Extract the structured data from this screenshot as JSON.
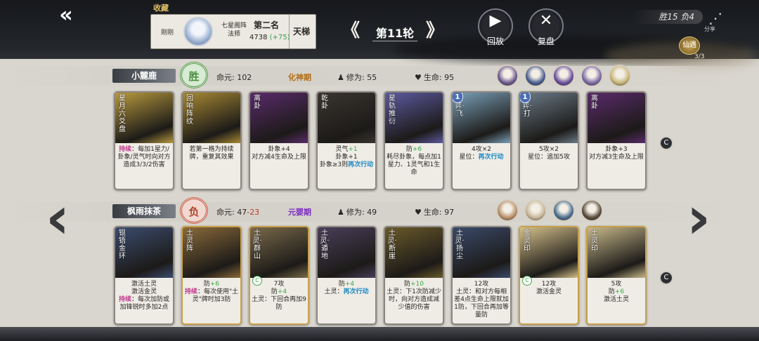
{
  "header": {
    "back_icon": "back-arrow-icon",
    "collect_label": "收藏",
    "player_card": {
      "sub_label": "刚刚",
      "name": "七星阁阵法师",
      "rank": "第二名",
      "score": "4738",
      "score_delta": "(+75)",
      "ladder_label": "天梯"
    },
    "round_title": "第11轮",
    "prev_icon": "chevron-left-icon",
    "next_icon": "chevron-right-icon",
    "replay_label": "回放",
    "review_label": "复盘",
    "record": "胜15 负4",
    "share_label": "分享",
    "quest": {
      "label": "仙遇",
      "count": "3/3"
    }
  },
  "players": [
    {
      "name": "小麓鹿",
      "result": "胜",
      "life_label": "命元:",
      "life_value": "102",
      "life_delta": "",
      "realm": "化神期",
      "cultivation": "修为: 55",
      "hp": "生命: 95",
      "avatar_colors": [
        "#6d5a8f",
        "#4c5e8e",
        "#6b4f9c",
        "#7c6aa4",
        "#c8b679"
      ],
      "cards": [
        {
          "name": "星月六爻盘",
          "badge": "",
          "art_color": "#b89a3e",
          "desc": [
            [
              "kw",
              "持续"
            ],
            [
              "",
              "：每加1星力/卦象/灵气时向对方造成3/3/2伤害"
            ]
          ]
        },
        {
          "name": "回响阵纹",
          "badge": "",
          "art_color": "#a88a33",
          "desc": [
            [
              "",
              "若第一格为持续牌，重复其效果"
            ]
          ]
        },
        {
          "name": "离卦",
          "badge": "",
          "art_color": "#5a2b6b",
          "desc": [
            [
              "",
              "卦象+4"
            ],
            [
              "br",
              ""
            ],
            [
              "",
              "对方减4生命及上限"
            ]
          ]
        },
        {
          "name": "乾卦",
          "badge": "",
          "art_color": "#3a3530",
          "desc": [
            [
              "",
              "灵气"
            ],
            [
              "pl",
              "+1"
            ],
            [
              "br",
              ""
            ],
            [
              "",
              "卦象+1"
            ],
            [
              "br",
              ""
            ],
            [
              "",
              "卦象≥3则"
            ],
            [
              "cy",
              "再次行动"
            ]
          ]
        },
        {
          "name": "星轨推衍",
          "badge": "",
          "art_color": "#5d5aa0",
          "desc": [
            [
              "",
              "防"
            ],
            [
              "pl",
              "+6"
            ],
            [
              "br",
              ""
            ],
            [
              "",
              "耗尽卦象，每点加1星力、1灵气和1生命"
            ]
          ]
        },
        {
          "name": "星弈·飞",
          "badge": "1",
          "art_color": "#7aa0b8",
          "desc": [
            [
              "",
              "4攻×2"
            ],
            [
              "br",
              ""
            ],
            [
              "",
              "星位："
            ],
            [
              "cy",
              "再次行动"
            ]
          ]
        },
        {
          "name": "星弈·打",
          "badge": "1",
          "art_color": "#6b7b88",
          "desc": [
            [
              "",
              "5攻×2"
            ],
            [
              "br",
              ""
            ],
            [
              "",
              "星位：追加5攻"
            ]
          ]
        },
        {
          "name": "离卦",
          "badge": "",
          "art_color": "#5a2b6b",
          "desc": [
            [
              "",
              "卦象+3"
            ],
            [
              "br",
              ""
            ],
            [
              "",
              "对方减3生命及上限"
            ]
          ]
        }
      ]
    },
    {
      "name": "枫雨抹茶",
      "result": "负",
      "life_label": "命元:",
      "life_value": "47",
      "life_delta": "-23",
      "realm": "元婴期",
      "cultivation": "修为: 49",
      "hp": "生命: 97",
      "avatar_colors": [
        "#b9906a",
        "#c9b79a",
        "#4c6d8e",
        "#5b4a3e"
      ],
      "cards": [
        {
          "name": "锟铻金环",
          "badge": "",
          "bubble": "",
          "art_color": "#3b4c6e",
          "desc": [
            [
              "",
              "激活土灵"
            ],
            [
              "br",
              ""
            ],
            [
              "",
              "激活金灵"
            ],
            [
              "br",
              ""
            ],
            [
              "kw",
              "持续"
            ],
            [
              "",
              "：每次加防或加锋锐时多加2点"
            ]
          ]
        },
        {
          "name": "土灵阵",
          "badge": "",
          "bubble": "",
          "art_color": "#8a6a3a",
          "desc": [
            [
              "",
              "防"
            ],
            [
              "pl",
              "+6"
            ],
            [
              "br",
              ""
            ],
            [
              "kw",
              "持续"
            ],
            [
              "",
              "：每次使用\"土灵\"牌时加3防"
            ]
          ]
        },
        {
          "name": "土灵·群山",
          "badge": "",
          "bubble": "C",
          "art_color": "#7a6a4a",
          "desc": [
            [
              "",
              "7攻"
            ],
            [
              "br",
              ""
            ],
            [
              "",
              "防"
            ],
            [
              "pl",
              "+4"
            ],
            [
              "br",
              ""
            ],
            [
              "",
              "土灵：下回合再加9防"
            ]
          ]
        },
        {
          "name": "土灵·遁地",
          "badge": "",
          "bubble": "",
          "art_color": "#4a3f5a",
          "desc": [
            [
              "",
              "防"
            ],
            [
              "pl",
              "+4"
            ],
            [
              "br",
              ""
            ],
            [
              "",
              "土灵："
            ],
            [
              "cy",
              "再次行动"
            ]
          ]
        },
        {
          "name": "土灵·断崖",
          "badge": "",
          "bubble": "",
          "art_color": "#6a5a2a",
          "desc": [
            [
              "",
              "防"
            ],
            [
              "pl",
              "+10"
            ],
            [
              "br",
              ""
            ],
            [
              "",
              "土灵：下1次防减少时，向对方造成减少值的伤害"
            ]
          ]
        },
        {
          "name": "土灵·扬尘",
          "badge": "",
          "bubble": "",
          "art_color": "#3a4a6a",
          "desc": [
            [
              "",
              "12攻"
            ],
            [
              "br",
              ""
            ],
            [
              "",
              "土灵：和对方每相差4点生命上限就加1防，下回合再加等量防"
            ]
          ]
        },
        {
          "name": "金灵印",
          "badge": "",
          "bubble": "C",
          "art_color": "#d4c08a",
          "desc": [
            [
              "",
              "12攻"
            ],
            [
              "br",
              ""
            ],
            [
              "",
              "激活金灵"
            ]
          ]
        },
        {
          "name": "土灵印",
          "badge": "",
          "bubble": "",
          "art_color": "#c7b88a",
          "desc": [
            [
              "",
              "5攻"
            ],
            [
              "br",
              ""
            ],
            [
              "",
              "防"
            ],
            [
              "pl",
              "+6"
            ],
            [
              "br",
              ""
            ],
            [
              "",
              "激活土灵"
            ]
          ]
        }
      ]
    }
  ],
  "side_icon_label": "C",
  "colors": {
    "accent_gold": "#e0c065",
    "green": "#3aa84a",
    "cyan": "#1d8ac4",
    "magenta": "#c13b8d",
    "red": "#c0392b"
  }
}
